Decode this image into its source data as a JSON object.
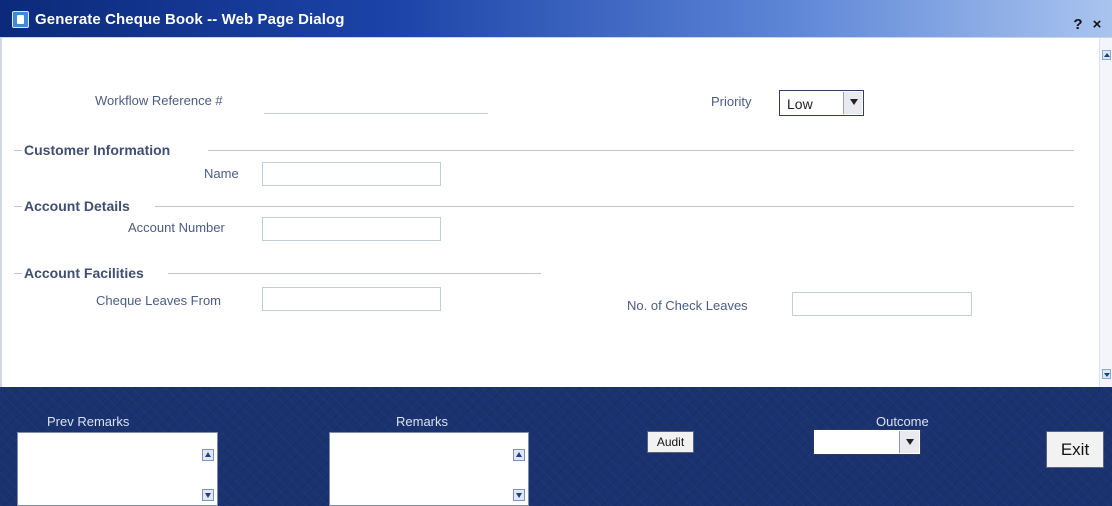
{
  "window": {
    "title": "Generate Cheque Book -- Web Page Dialog",
    "help_label": "?",
    "close_label": "×"
  },
  "form": {
    "workflow_reference_label": "Workflow Reference #",
    "workflow_reference_value": "",
    "priority_label": "Priority",
    "priority_value": "Low",
    "customer_section": "Customer Information",
    "name_label": "Name",
    "name_value": "",
    "account_section": "Account Details",
    "account_number_label": "Account Number",
    "account_number_value": "",
    "facilities_section": "Account Facilities",
    "cheque_leaves_from_label": "Cheque Leaves From",
    "cheque_leaves_from_value": "",
    "check_leaves_label": "No. of Check Leaves",
    "check_leaves_value": ""
  },
  "footer": {
    "prev_remarks_label": "Prev Remarks",
    "remarks_label": "Remarks",
    "audit_label": "Audit",
    "outcome_label": "Outcome",
    "outcome_value": "",
    "exit_label": "Exit"
  },
  "icons": {
    "title_icon": "browser-dialog-icon",
    "scroll_up": "arrow-up-icon",
    "scroll_down": "arrow-down-icon",
    "select_arrow": "chevron-down-icon"
  }
}
